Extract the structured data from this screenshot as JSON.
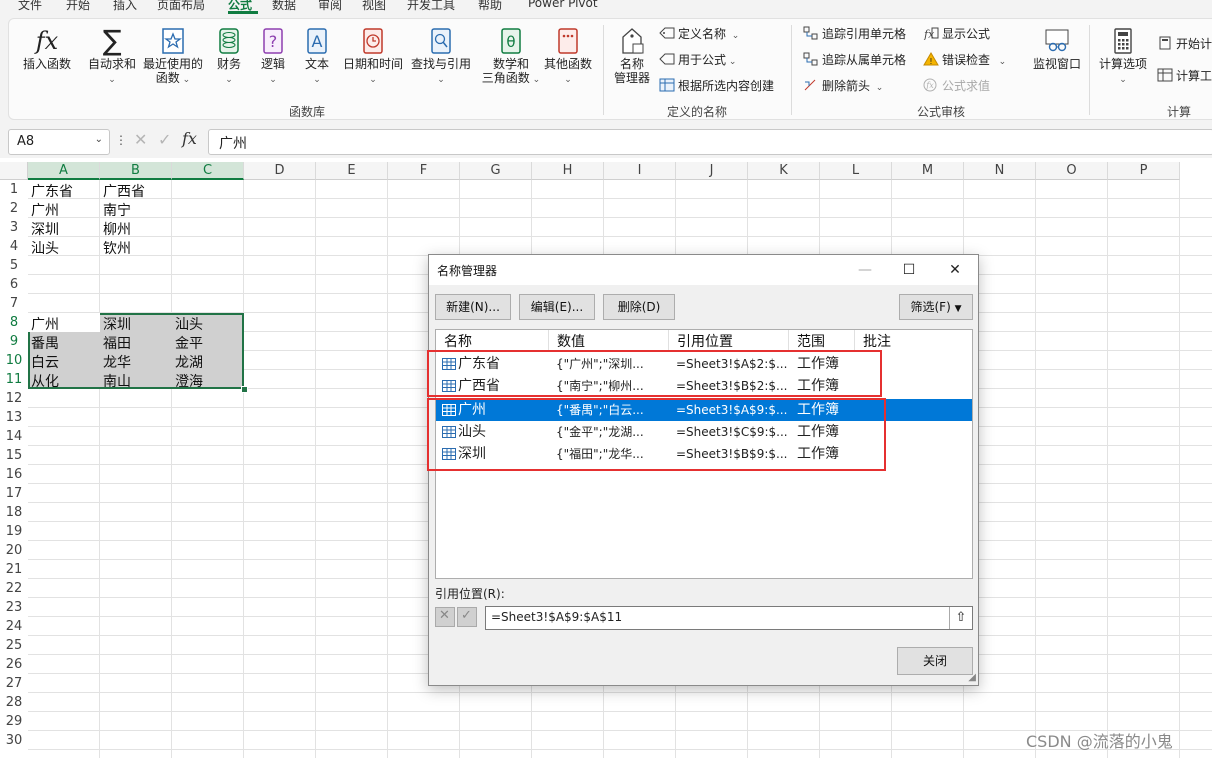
{
  "menu": {
    "items": [
      "文件",
      "开始",
      "插入",
      "页面布局",
      "公式",
      "数据",
      "审阅",
      "视图",
      "开发工具",
      "帮助",
      "Power Pivot"
    ],
    "active": "公式"
  },
  "ribbon": {
    "function_library": {
      "insert_function": "插入函数",
      "autosum": "自动求和",
      "recent_1": "最近使用的",
      "recent_2": "函数",
      "financial": "财务",
      "logical": "逻辑",
      "text": "文本",
      "datetime": "日期和时间",
      "lookup": "查找与引用",
      "math_1": "数学和",
      "math_2": "三角函数",
      "other": "其他函数",
      "group_label": "函数库"
    },
    "defined_names": {
      "name_manager_1": "名称",
      "name_manager_2": "管理器",
      "define_name": "定义名称",
      "use_in_formula": "用于公式",
      "create_from_selection": "根据所选内容创建",
      "group_label": "定义的名称"
    },
    "formula_auditing": {
      "trace_precedents": "追踪引用单元格",
      "trace_dependents": "追踪从属单元格",
      "remove_arrows": "删除箭头",
      "show_formulas": "显示公式",
      "error_checking": "错误检查",
      "evaluate_formula": "公式求值",
      "watch_window": "监视窗口",
      "group_label": "公式审核"
    },
    "calculation": {
      "calc_options": "计算选项",
      "calc_now": "开始计",
      "calc_sheet": "计算工",
      "group_label": "计算"
    },
    "fx_glyph": "fx"
  },
  "formula_bar": {
    "name_box": "A8",
    "formula": "广州",
    "fx_label": "fx"
  },
  "sheet": {
    "columns": [
      "A",
      "B",
      "C",
      "D",
      "E",
      "F",
      "G",
      "H",
      "I",
      "J",
      "K",
      "L",
      "M",
      "N",
      "O",
      "P"
    ],
    "rows": [
      "1",
      "2",
      "3",
      "4",
      "5",
      "6",
      "7",
      "8",
      "9",
      "10",
      "11",
      "12",
      "13",
      "14",
      "15",
      "16",
      "17",
      "18",
      "19",
      "20",
      "21",
      "22",
      "23",
      "24",
      "25",
      "26",
      "27",
      "28",
      "29",
      "30"
    ],
    "cells": {
      "A1": "广东省",
      "B1": "广西省",
      "A2": "广州",
      "B2": "南宁",
      "A3": "深圳",
      "B3": "柳州",
      "A4": "汕头",
      "B4": "钦州",
      "A8": "广州",
      "B8": "深圳",
      "C8": "汕头",
      "A9": "番禺",
      "B9": "福田",
      "C9": "金平",
      "A10": "白云",
      "B10": "龙华",
      "C10": "龙湖",
      "A11": "从化",
      "B11": "南山",
      "C11": "澄海"
    }
  },
  "dialog": {
    "title": "名称管理器",
    "buttons": {
      "new": "新建(N)...",
      "edit": "编辑(E)...",
      "delete": "删除(D)",
      "filter": "筛选(F)",
      "close": "关闭"
    },
    "columns": [
      "名称",
      "数值",
      "引用位置",
      "范围",
      "批注"
    ],
    "names": [
      {
        "name": "广东省",
        "value": "{\"广州\";\"深圳...",
        "refers_to": "=Sheet3!$A$2:$...",
        "scope": "工作簿",
        "selected": false
      },
      {
        "name": "广西省",
        "value": "{\"南宁\";\"柳州...",
        "refers_to": "=Sheet3!$B$2:$...",
        "scope": "工作簿",
        "selected": false
      },
      {
        "name": "广州",
        "value": "{\"番禺\";\"白云...",
        "refers_to": "=Sheet3!$A$9:$...",
        "scope": "工作簿",
        "selected": true
      },
      {
        "name": "汕头",
        "value": "{\"金平\";\"龙湖...",
        "refers_to": "=Sheet3!$C$9:$...",
        "scope": "工作簿",
        "selected": false
      },
      {
        "name": "深圳",
        "value": "{\"福田\";\"龙华...",
        "refers_to": "=Sheet3!$B$9:$...",
        "scope": "工作簿",
        "selected": false
      }
    ],
    "ref_label": "引用位置(R):",
    "ref_value": "=Sheet3!$A$9:$A$11"
  },
  "watermark": "CSDN @流落的小鬼",
  "colors": {
    "accent": "#107c41",
    "selection_blue": "#0078d7",
    "annotation_red": "#e53030"
  }
}
